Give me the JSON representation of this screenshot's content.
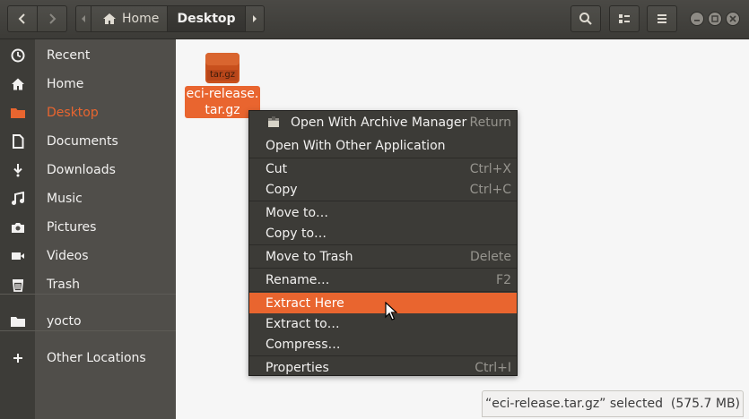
{
  "breadcrumb": {
    "home_label": "Home",
    "current_label": "Desktop"
  },
  "sidebar": {
    "items": [
      {
        "label": "Recent",
        "icon": "clock-icon"
      },
      {
        "label": "Home",
        "icon": "home-icon"
      },
      {
        "label": "Desktop",
        "icon": "folder-icon"
      },
      {
        "label": "Documents",
        "icon": "document-icon"
      },
      {
        "label": "Downloads",
        "icon": "download-icon"
      },
      {
        "label": "Music",
        "icon": "music-icon"
      },
      {
        "label": "Pictures",
        "icon": "camera-icon"
      },
      {
        "label": "Videos",
        "icon": "video-icon"
      },
      {
        "label": "Trash",
        "icon": "trash-icon"
      },
      {
        "label": "yocto",
        "icon": "folder-icon"
      },
      {
        "label": "Other Locations",
        "icon": "plus-icon"
      }
    ]
  },
  "file": {
    "name": "eci-release.\ntar.gz",
    "icon_text": "tar.gz"
  },
  "context_menu": {
    "items": [
      {
        "label": "Open With Archive Manager",
        "accel": "Return"
      },
      {
        "label": "Open With Other Application",
        "accel": ""
      },
      {
        "label": "Cut",
        "accel": "Ctrl+X"
      },
      {
        "label": "Copy",
        "accel": "Ctrl+C"
      },
      {
        "label": "Move to…",
        "accel": ""
      },
      {
        "label": "Copy to…",
        "accel": ""
      },
      {
        "label": "Move to Trash",
        "accel": "Delete"
      },
      {
        "label": "Rename…",
        "accel": "F2"
      },
      {
        "label": "Extract Here",
        "accel": ""
      },
      {
        "label": "Extract to…",
        "accel": ""
      },
      {
        "label": "Compress…",
        "accel": ""
      },
      {
        "label": "Properties",
        "accel": "Ctrl+I"
      }
    ]
  },
  "status": {
    "text": "“eci-release.tar.gz” selected  (575.7 MB)"
  },
  "colors": {
    "accent": "#e9652f",
    "sidebar": "#504e4a",
    "titlebar": "#3c3b37"
  }
}
